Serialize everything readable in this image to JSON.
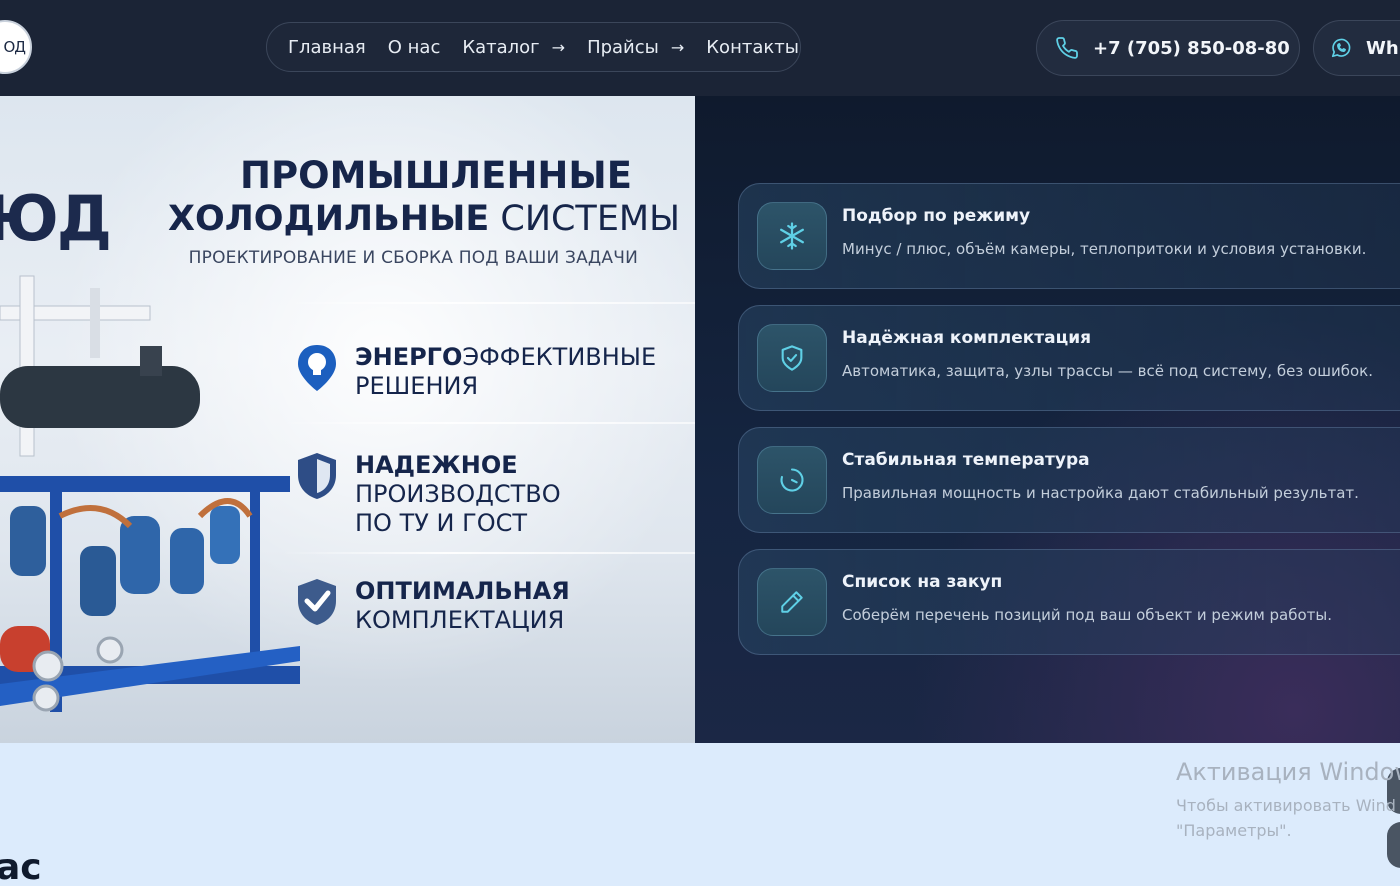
{
  "header": {
    "logo_text": "ОД",
    "nav": [
      {
        "label": "Главная",
        "has_arrow": false
      },
      {
        "label": "О нас",
        "has_arrow": false
      },
      {
        "label": "Каталог",
        "has_arrow": true
      },
      {
        "label": "Прайсы",
        "has_arrow": true
      },
      {
        "label": "Контакты",
        "has_arrow": false
      }
    ],
    "phone": "+7 (705) 850-08-80",
    "whatsapp_label": "Wh"
  },
  "hero_image": {
    "brand": "ЮД",
    "title_line1": "ПРОМЫШЛЕННЫЕ",
    "title_line2_bold": "ХОЛОДИЛЬНЫЕ",
    "title_line2_rest": " СИСТЕМЫ",
    "subtitle": "ПРОЕКТИРОВАНИЕ И СБОРКА ПОД ВАШИ ЗАДАЧИ",
    "features": [
      {
        "bold": "ЭНЕРГО",
        "rest": "ЭФФЕКТИВНЫЕ",
        "line2": "РЕШЕНИЯ",
        "line3": "",
        "icon": "lightbulb-icon"
      },
      {
        "bold": "НАДЕЖНОЕ",
        "rest": "",
        "line2": "ПРОИЗВОДСТВО",
        "line3": "ПО ТУ И ГОСТ",
        "icon": "shield-icon"
      },
      {
        "bold": "ОПТИМАЛЬНАЯ",
        "rest": "",
        "line2": "КОМПЛЕКТАЦИЯ",
        "line3": "",
        "icon": "shield-check-icon"
      }
    ]
  },
  "cards": [
    {
      "title": "Подбор по режиму",
      "desc": "Минус / плюс, объём камеры, теплопритоки и условия установки.",
      "icon": "snowflake-icon"
    },
    {
      "title": "Надёжная комплектация",
      "desc": "Автоматика, защита, узлы трассы — всё под систему, без ошибок.",
      "icon": "shield-check-icon"
    },
    {
      "title": "Стабильная температура",
      "desc": "Правильная мощность и настройка дают стабильный результат.",
      "icon": "gauge-icon"
    },
    {
      "title": "Список на закуп",
      "desc": "Соберём перечень позиций под ваш объект и режим работы.",
      "icon": "pencil-icon"
    }
  ],
  "bottom": {
    "heading_fragment": "ас"
  },
  "watermark": {
    "line1": "Активация Window",
    "line2": "Чтобы активировать Wind",
    "line3": "\"Параметры\"."
  },
  "colors": {
    "header_bg": "#1b2436",
    "accent_cyan": "#5fd0e6",
    "hero_title": "#16254a",
    "bottom_bg": "#dcebfc"
  }
}
